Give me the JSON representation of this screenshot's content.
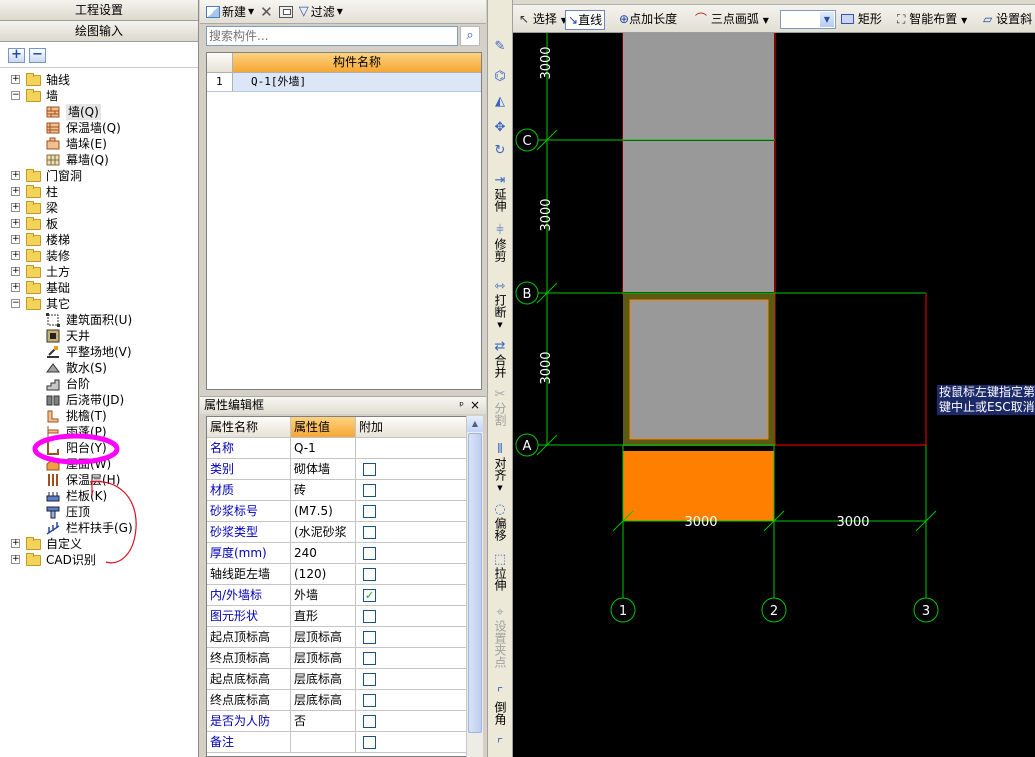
{
  "left_panel": {
    "project_settings": "工程设置",
    "drawing_input": "绘图输入",
    "tree": {
      "axis": "轴线",
      "wall": "墙",
      "wall_children": [
        "墙(Q)",
        "保温墙(Q)",
        "墙垛(E)",
        "幕墙(Q)"
      ],
      "door_window": "门窗洞",
      "column": "柱",
      "beam": "梁",
      "slab": "板",
      "stair": "楼梯",
      "decoration": "装修",
      "earthwork": "土方",
      "foundation": "基础",
      "other": "其它",
      "other_children": [
        "建筑面积(U)",
        "天井",
        "平整场地(V)",
        "散水(S)",
        "台阶",
        "后浇带(JD)",
        "挑檐(T)",
        "雨蓬(P)",
        "阳台(Y)",
        "屋面(W)",
        "保温层(H)",
        "栏板(K)",
        "压顶",
        "栏杆扶手(G)"
      ],
      "custom": "自定义",
      "cad_recognition": "CAD识别"
    }
  },
  "component_panel": {
    "new_label": "新建",
    "filter_label": "过滤",
    "search_placeholder": "搜索构件...",
    "column_header": "构件名称",
    "rows": [
      {
        "index": "1",
        "name": "Q-1[外墙]"
      }
    ]
  },
  "property_panel": {
    "title": "属性编辑框",
    "pin": "ᵖ",
    "close": "×",
    "headers": {
      "name": "属性名称",
      "value": "属性值",
      "extra": "附加"
    },
    "rows": [
      {
        "name": "名称",
        "value": "Q-1",
        "blue": true,
        "checkbox": false
      },
      {
        "name": "类别",
        "value": "砌体墙",
        "blue": true,
        "checkbox": true,
        "checked": false
      },
      {
        "name": "材质",
        "value": "砖",
        "blue": true,
        "checkbox": true,
        "checked": false
      },
      {
        "name": "砂浆标号",
        "value": "(M7.5)",
        "blue": true,
        "checkbox": true,
        "checked": false
      },
      {
        "name": "砂浆类型",
        "value": "(水泥砂浆",
        "blue": true,
        "checkbox": true,
        "checked": false
      },
      {
        "name": "厚度(mm)",
        "value": "240",
        "blue": true,
        "checkbox": true,
        "checked": false
      },
      {
        "name": "轴线距左墙",
        "value": "(120)",
        "blue": false,
        "checkbox": true,
        "checked": false
      },
      {
        "name": "内/外墙标",
        "value": "外墙",
        "blue": true,
        "checkbox": true,
        "checked": true
      },
      {
        "name": "图元形状",
        "value": "直形",
        "blue": true,
        "checkbox": true,
        "checked": false
      },
      {
        "name": "起点顶标高",
        "value": "层顶标高",
        "blue": false,
        "checkbox": true,
        "checked": false
      },
      {
        "name": "终点顶标高",
        "value": "层顶标高",
        "blue": false,
        "checkbox": true,
        "checked": false
      },
      {
        "name": "起点底标高",
        "value": "层底标高",
        "blue": false,
        "checkbox": true,
        "checked": false
      },
      {
        "name": "终点底标高",
        "value": "层底标高",
        "blue": false,
        "checkbox": true,
        "checked": false
      },
      {
        "name": "是否为人防",
        "value": "否",
        "blue": true,
        "checkbox": true,
        "checked": false
      },
      {
        "name": "备注",
        "value": "",
        "blue": true,
        "checkbox": true,
        "checked": false
      }
    ]
  },
  "vertical_toolbar": {
    "extend": "延伸",
    "trim": "修剪",
    "break": "打断",
    "merge": "合并",
    "split": "分割",
    "align": "对齐",
    "offset": "偏移",
    "stretch": "拉伸",
    "set_grip": "设置夹点",
    "fillet": "倒角"
  },
  "draw_toolbar": {
    "select": "选择",
    "line": "直线",
    "point_length": "点加长度",
    "three_point_arc": "三点画弧",
    "rectangle": "矩形",
    "smart_layout": "智能布置",
    "settings": "设置斜"
  },
  "canvas": {
    "axis_labels": {
      "a": "A",
      "b": "B",
      "c": "C",
      "n1": "1",
      "n2": "2",
      "n3": "3"
    },
    "dimensions": {
      "v1": "3000",
      "v2": "3000",
      "v3": "3000",
      "h1": "3000",
      "h2": "3000"
    },
    "tip_lines": [
      "按鼠标左键指定第",
      "键中止或ESC取消"
    ]
  },
  "colors": {
    "canvas_bg": "#000000",
    "axis": "#00c800",
    "wall_red": "#ff0000",
    "gray_fill": "#999999",
    "orange": "#ff8000",
    "wall_border": "#5a5a14",
    "highlight_circle": "#ff00ff"
  }
}
